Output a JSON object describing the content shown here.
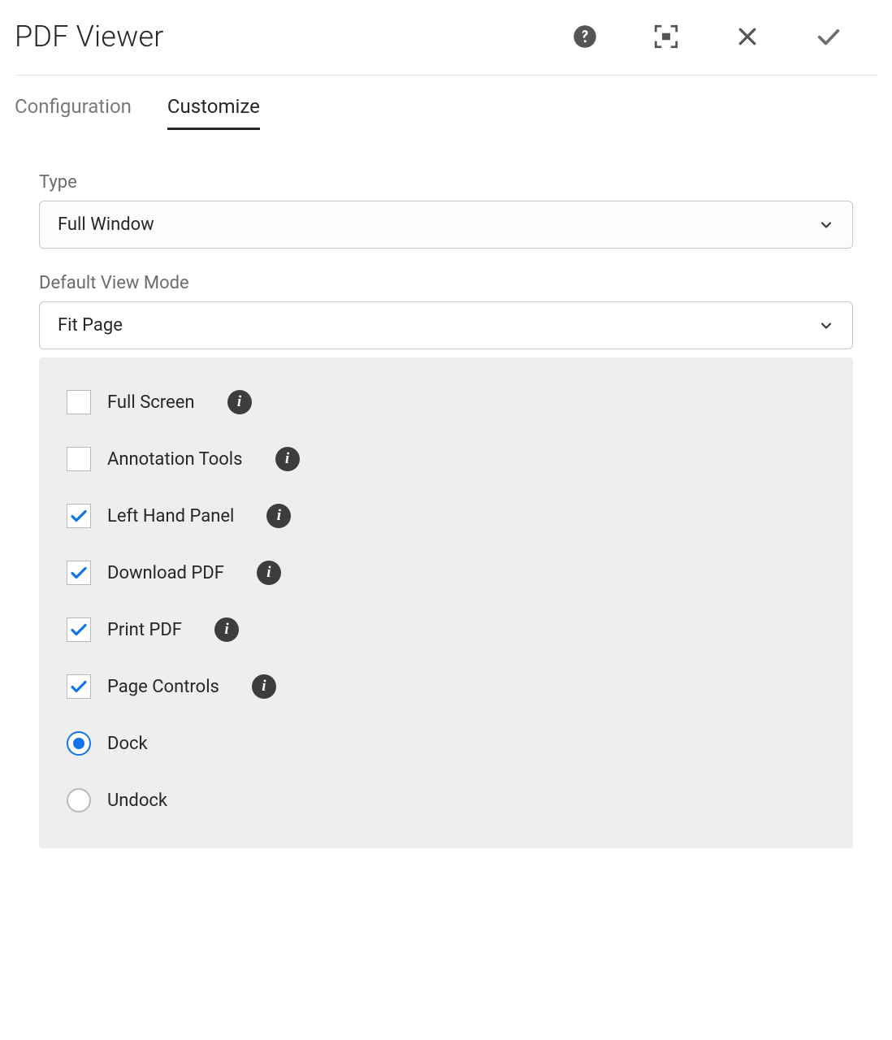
{
  "header": {
    "title": "PDF Viewer"
  },
  "tabs": {
    "configuration": "Configuration",
    "customize": "Customize",
    "active": "customize"
  },
  "fields": {
    "type": {
      "label": "Type",
      "value": "Full Window"
    },
    "defaultViewMode": {
      "label": "Default View Mode",
      "value": "Fit Page"
    }
  },
  "options": {
    "fullScreen": {
      "label": "Full Screen",
      "checked": false
    },
    "annotationTools": {
      "label": "Annotation Tools",
      "checked": false
    },
    "leftHandPanel": {
      "label": "Left Hand Panel",
      "checked": true
    },
    "downloadPdf": {
      "label": "Download PDF",
      "checked": true
    },
    "printPdf": {
      "label": "Print PDF",
      "checked": true
    },
    "pageControls": {
      "label": "Page Controls",
      "checked": true
    }
  },
  "dockMode": {
    "dock": {
      "label": "Dock",
      "selected": true
    },
    "undock": {
      "label": "Undock",
      "selected": false
    }
  },
  "icons": {
    "info": "i"
  }
}
